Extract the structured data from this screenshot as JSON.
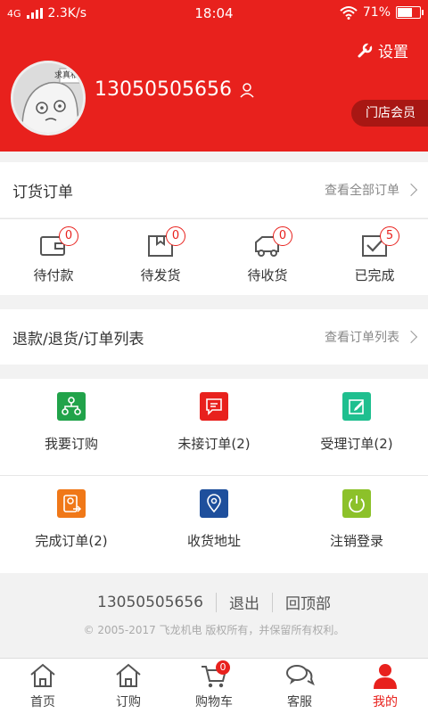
{
  "status_bar": {
    "network": "4G",
    "speed": "2.3K/s",
    "time": "18:04",
    "battery": "71%",
    "battery_level": 0.71
  },
  "header": {
    "settings_label": "设置",
    "phone": "13050505656",
    "member_badge": "门店会员",
    "avatar_text": "求真相"
  },
  "orders": {
    "title": "订货订单",
    "more": "查看全部订单",
    "statuses": [
      {
        "label": "待付款",
        "count": "0"
      },
      {
        "label": "待发货",
        "count": "0"
      },
      {
        "label": "待收货",
        "count": "0"
      },
      {
        "label": "已完成",
        "count": "5"
      }
    ]
  },
  "refunds": {
    "title": "退款/退货/订单列表",
    "more": "查看订单列表"
  },
  "grid": [
    {
      "label": "我要订购",
      "color": "#21a34a",
      "icon": "org-chart-icon"
    },
    {
      "label": "未接订单(2)",
      "color": "#e8211d",
      "icon": "message-icon"
    },
    {
      "label": "受理订单(2)",
      "color": "#1fbf8f",
      "icon": "edit-icon"
    },
    {
      "label": "完成订单(2)",
      "color": "#f07818",
      "icon": "user-transfer-icon"
    },
    {
      "label": "收货地址",
      "color": "#1e4f9c",
      "icon": "location-icon"
    },
    {
      "label": "注销登录",
      "color": "#8cc12a",
      "icon": "power-icon"
    }
  ],
  "footer": {
    "phone": "13050505656",
    "logout": "退出",
    "top": "回顶部",
    "copyright": "© 2005-2017 飞龙机电 版权所有，并保留所有权利。"
  },
  "tabbar": [
    {
      "label": "首页",
      "icon": "home-icon"
    },
    {
      "label": "订购",
      "icon": "home-icon"
    },
    {
      "label": "购物车",
      "icon": "cart-icon",
      "badge": "0"
    },
    {
      "label": "客服",
      "icon": "chat-icon"
    },
    {
      "label": "我的",
      "icon": "user-icon",
      "active": true
    }
  ]
}
